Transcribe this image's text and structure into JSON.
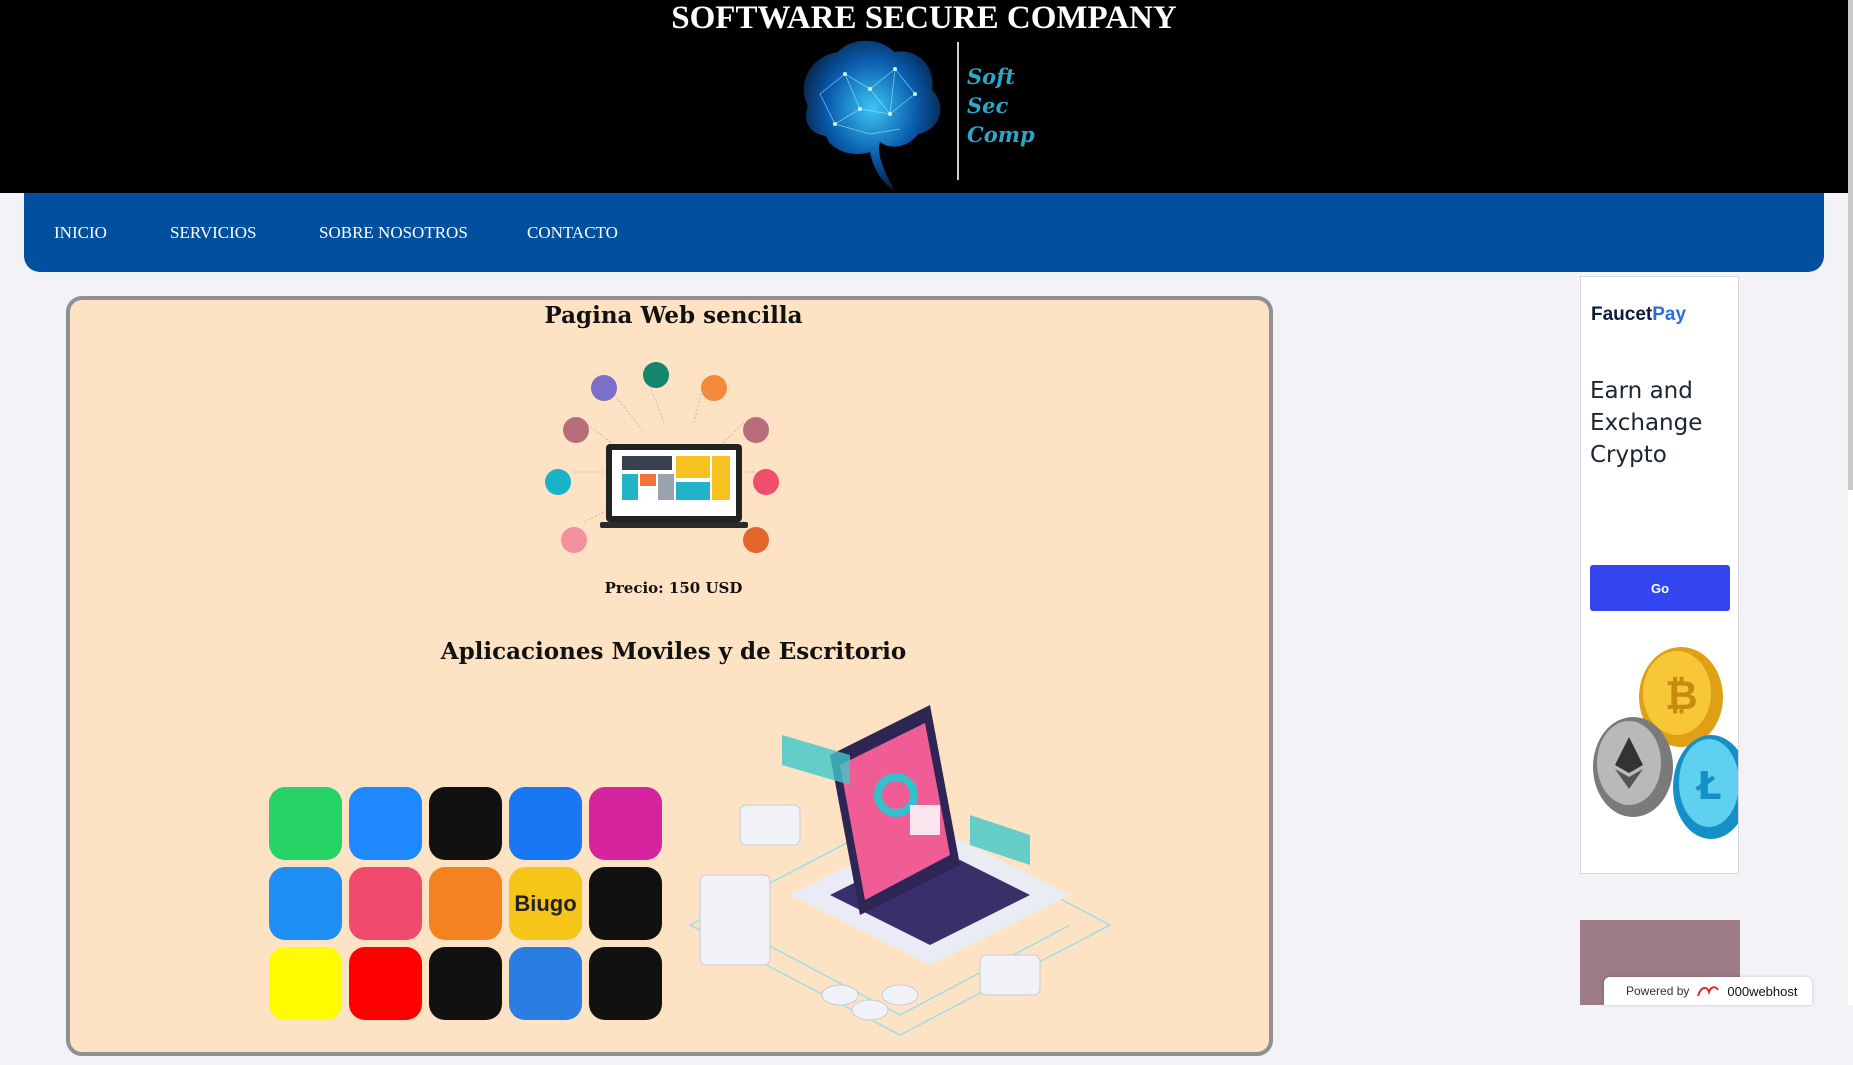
{
  "header": {
    "title": "SOFTWARE SECURE COMPANY",
    "logo_text": [
      "Soft",
      "Sec",
      "Comp"
    ]
  },
  "nav": {
    "items": [
      "INICIO",
      "SERVICIOS",
      "SOBRE NOSOTROS",
      "CONTACTO"
    ]
  },
  "main": {
    "section1_title": "Pagina Web sencilla",
    "section1_price": "Precio: 150 USD",
    "section2_title": "Aplicaciones Moviles y de Escritorio",
    "apps": [
      {
        "icon": "whatsapp-icon",
        "color": "#25d366"
      },
      {
        "icon": "messenger-icon",
        "color": "#1e88ff"
      },
      {
        "icon": "tiktok-icon",
        "color": "#111111"
      },
      {
        "icon": "facebook-icon",
        "color": "#1877f2"
      },
      {
        "icon": "instagram-icon",
        "color": "#d6249f"
      },
      {
        "icon": "shareit-icon",
        "color": "#1f8ff5"
      },
      {
        "icon": "likee-icon",
        "color": "#f04a6c"
      },
      {
        "icon": "uc-browser-icon",
        "color": "#f58220"
      },
      {
        "icon": "biugo-icon",
        "color": "#f5c518",
        "label": "Biugo"
      },
      {
        "icon": "hotstar-icon",
        "color": "#111111"
      },
      {
        "icon": "snapchat-icon",
        "color": "#fffc00"
      },
      {
        "icon": "youtube-icon",
        "color": "#ff0000"
      },
      {
        "icon": "netflix-icon",
        "color": "#111111"
      },
      {
        "icon": "video-player-icon",
        "color": "#2a7de1"
      },
      {
        "icon": "spotify-icon",
        "color": "#111111"
      }
    ]
  },
  "ad": {
    "brand_a": "Faucet",
    "brand_b": "Pay",
    "headline": "Earn and Exchange Crypto",
    "cta": "Go",
    "powered_label": "Powered by",
    "powered_brand": "000webhost"
  },
  "colors": {
    "nav_bg": "#01509e",
    "card_bg": "#fde3c4",
    "ad_button": "#3446f0"
  }
}
